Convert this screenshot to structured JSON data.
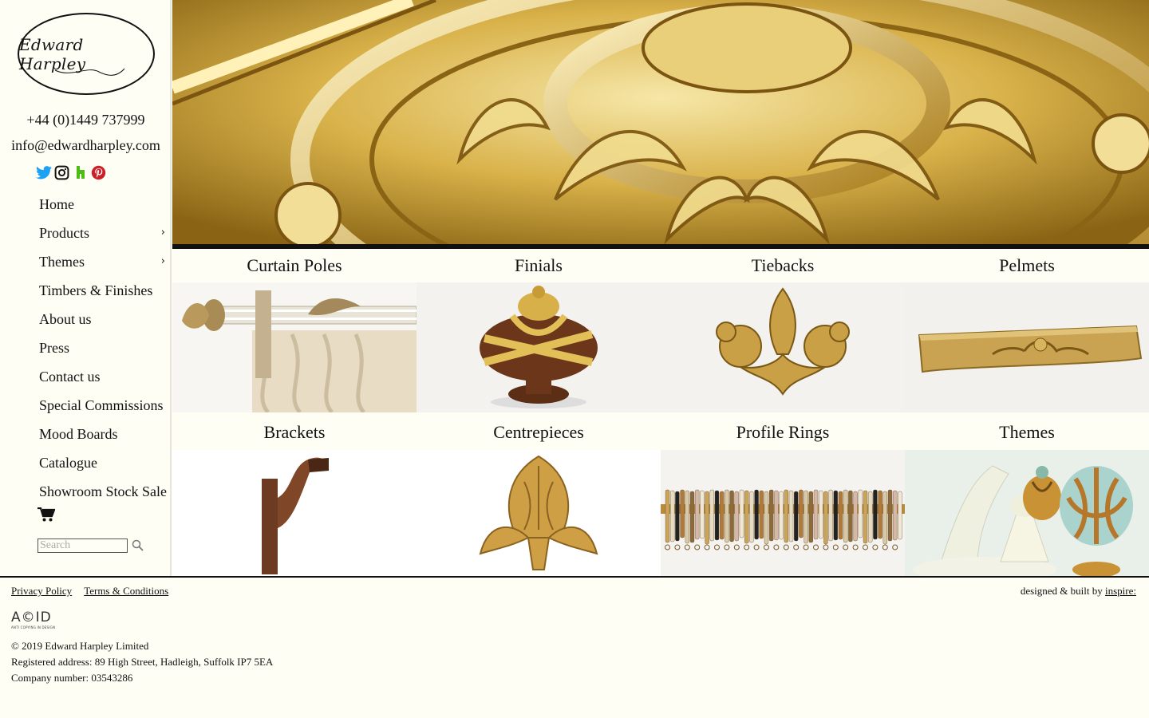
{
  "brand": {
    "name": "Edward Harpley"
  },
  "contact": {
    "phone": "+44 (0)1449 737999",
    "email": "info@edwardharpley.com"
  },
  "socials": [
    {
      "icon": "twitter-icon",
      "color": "#1da1f2"
    },
    {
      "icon": "instagram-icon",
      "color": "#111111"
    },
    {
      "icon": "houzz-icon",
      "color": "#4dbc15"
    },
    {
      "icon": "pinterest-icon",
      "color": "#cb2027"
    }
  ],
  "nav": {
    "items": [
      {
        "label": "Home",
        "has_submenu": false
      },
      {
        "label": "Products",
        "has_submenu": true
      },
      {
        "label": "Themes",
        "has_submenu": true
      },
      {
        "label": "Timbers & Finishes",
        "has_submenu": false
      },
      {
        "label": "About us",
        "has_submenu": false
      },
      {
        "label": "Press",
        "has_submenu": false
      },
      {
        "label": "Contact us",
        "has_submenu": false
      },
      {
        "label": "Special Commissions",
        "has_submenu": false
      },
      {
        "label": "Mood Boards",
        "has_submenu": false
      },
      {
        "label": "Catalogue",
        "has_submenu": false
      },
      {
        "label": "Showroom Stock Sale",
        "has_submenu": false
      }
    ],
    "chevron": "›"
  },
  "search": {
    "placeholder": "Search",
    "value": ""
  },
  "tiles": [
    {
      "label": "Curtain Poles"
    },
    {
      "label": "Finials"
    },
    {
      "label": "Tiebacks"
    },
    {
      "label": "Pelmets"
    },
    {
      "label": "Brackets"
    },
    {
      "label": "Centrepieces"
    },
    {
      "label": "Profile Rings"
    },
    {
      "label": "Themes"
    }
  ],
  "footer": {
    "privacy": "Privacy Policy",
    "terms": "Terms & Conditions",
    "credit_prefix": "designed & built by ",
    "credit_link": "inspire:",
    "acid": "A©ID",
    "acid_sub": "ANTI COPYING IN DESIGN",
    "copyright": "© 2019 Edward Harpley Limited",
    "address": "Registered address: 89 High Street, Hadleigh, Suffolk IP7 5EA",
    "company": "Company number: 03543286"
  },
  "colors": {
    "background": "#fffef5",
    "gold": "#c99a2e",
    "text": "#111111"
  }
}
